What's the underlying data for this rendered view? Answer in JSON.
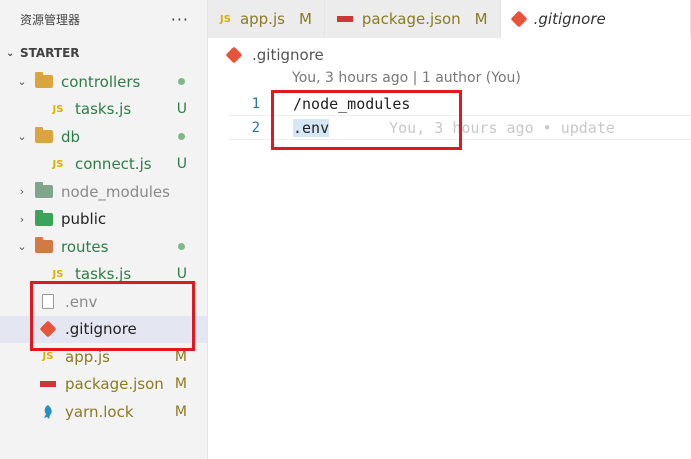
{
  "explorer": {
    "title": "资源管理器",
    "more": "···",
    "section": "STARTER",
    "items": [
      {
        "label": "controllers",
        "icon": "controllers-folder-icon",
        "badge": "dot",
        "indent": 0,
        "arrow": "open"
      },
      {
        "label": "tasks.js",
        "icon": "js-file-icon",
        "badge": "U",
        "indent": 1
      },
      {
        "label": "db",
        "icon": "db-folder-icon",
        "badge": "dot",
        "indent": 0,
        "arrow": "open"
      },
      {
        "label": "connect.js",
        "icon": "js-file-icon",
        "badge": "U",
        "indent": 1
      },
      {
        "label": "node_modules",
        "icon": "node-modules-folder-icon",
        "badge": "",
        "indent": 0,
        "arrow": "closed"
      },
      {
        "label": "public",
        "icon": "public-folder-icon",
        "badge": "",
        "indent": 0,
        "arrow": "closed"
      },
      {
        "label": "routes",
        "icon": "routes-folder-icon",
        "badge": "dot",
        "indent": 0,
        "arrow": "open"
      },
      {
        "label": "tasks.js",
        "icon": "js-file-icon",
        "badge": "U",
        "indent": 1
      },
      {
        "label": ".env",
        "icon": "file-icon",
        "badge": "",
        "indent": 0
      },
      {
        "label": ".gitignore",
        "icon": "git-icon",
        "badge": "",
        "indent": 0
      },
      {
        "label": "app.js",
        "icon": "js-file-icon",
        "badge": "M",
        "indent": 0
      },
      {
        "label": "package.json",
        "icon": "npm-icon",
        "badge": "M",
        "indent": 0
      },
      {
        "label": "yarn.lock",
        "icon": "yarn-icon",
        "badge": "M",
        "indent": 0
      }
    ]
  },
  "tabs": [
    {
      "label": "app.js",
      "icon": "js-file-icon",
      "badge": "M",
      "active": false
    },
    {
      "label": "package.json",
      "icon": "npm-icon",
      "badge": "M",
      "active": false
    },
    {
      "label": ".gitignore",
      "icon": "git-icon",
      "badge": "",
      "active": true
    }
  ],
  "editor": {
    "breadcrumb": ".gitignore",
    "codelens": "You, 3 hours ago | 1 author (You)",
    "lines": [
      {
        "number": "1",
        "text": "/node_modules"
      },
      {
        "number": "2",
        "text": ".env",
        "blame": "You, 3 hours ago • update"
      }
    ]
  },
  "icons": {
    "js": "JS"
  },
  "colors": {
    "highlight_box": "#e1191f",
    "untracked": "#2d7d46",
    "modified": "#8a7a22"
  }
}
